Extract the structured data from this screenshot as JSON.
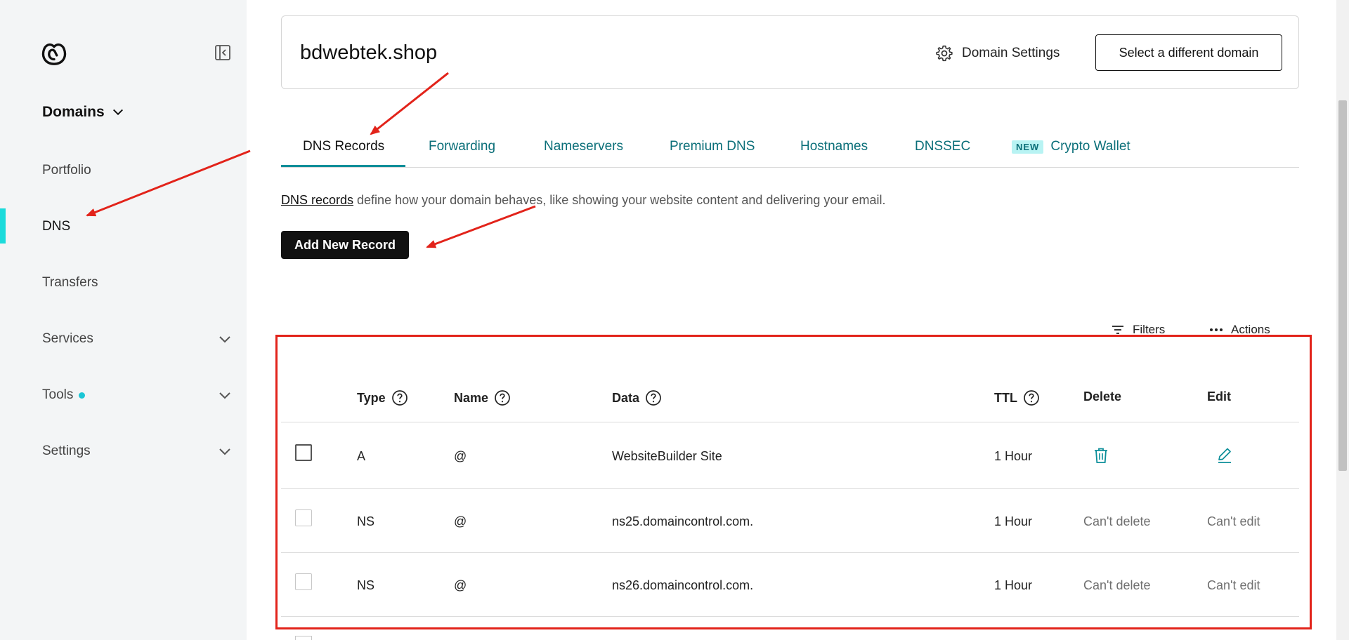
{
  "sidebar": {
    "title": "Domains",
    "items": [
      {
        "label": "Portfolio"
      },
      {
        "label": "DNS"
      },
      {
        "label": "Transfers"
      },
      {
        "label": "Services"
      },
      {
        "label": "Tools"
      },
      {
        "label": "Settings"
      }
    ],
    "active_item": "DNS",
    "accent_color": "#1bdbdb"
  },
  "domain": {
    "name": "bdwebtek.shop",
    "settings_label": "Domain Settings",
    "select_label": "Select a different domain"
  },
  "tabs": [
    {
      "label": "DNS Records"
    },
    {
      "label": "Forwarding"
    },
    {
      "label": "Nameservers"
    },
    {
      "label": "Premium DNS"
    },
    {
      "label": "Hostnames"
    },
    {
      "label": "DNSSEC"
    },
    {
      "label": "Crypto Wallet",
      "badge": "NEW"
    }
  ],
  "description": {
    "link_text": "DNS records",
    "rest": " define how your domain behaves, like showing your website content and delivering your email."
  },
  "add_button": "Add New Record",
  "toolbar": {
    "filters": "Filters",
    "actions": "Actions"
  },
  "table": {
    "headers": {
      "type": "Type",
      "name": "Name",
      "data": "Data",
      "ttl": "TTL",
      "delete": "Delete",
      "edit": "Edit"
    },
    "rows": [
      {
        "type": "A",
        "name": "@",
        "data": "WebsiteBuilder Site",
        "ttl": "1 Hour",
        "delete": "",
        "edit": ""
      },
      {
        "type": "NS",
        "name": "@",
        "data": "ns25.domaincontrol.com.",
        "ttl": "1 Hour",
        "delete": "Can't delete",
        "edit": "Can't edit"
      },
      {
        "type": "NS",
        "name": "@",
        "data": "ns26.domaincontrol.com.",
        "ttl": "1 Hour",
        "delete": "Can't delete",
        "edit": "Can't edit"
      }
    ]
  },
  "colors": {
    "tab_link": "#0b6f79",
    "annotation": "#e2231a",
    "primary_button": "#111111"
  }
}
